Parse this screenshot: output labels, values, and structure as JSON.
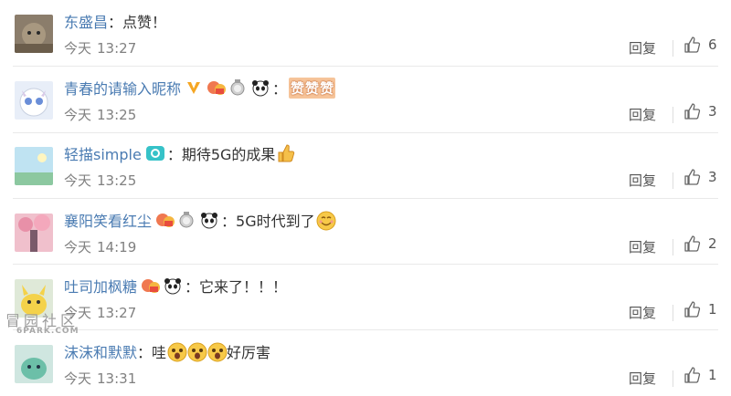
{
  "comments": [
    {
      "user": "东盛昌",
      "sep": "：",
      "text": "点赞！",
      "time_label": "今天",
      "time": "13:27",
      "reply": "回复",
      "likes": "6",
      "badges": [],
      "emoji": []
    },
    {
      "user": "青春的请输入昵称",
      "sep": "：",
      "text": "",
      "zan": [
        "赞",
        "赞",
        "赞"
      ],
      "time_label": "今天",
      "time": "13:25",
      "reply": "回复",
      "likes": "3",
      "badges": [
        "vip-v-icon",
        "fans-badge-icon",
        "medal-icon",
        "panda-icon"
      ],
      "emoji": []
    },
    {
      "user": "轻描simple",
      "sep": "：",
      "text": "期待5G的成果",
      "time_label": "今天",
      "time": "13:25",
      "reply": "回复",
      "likes": "3",
      "badges": [
        "camera-badge-icon"
      ],
      "emoji": [
        "thumbs-up-emoji"
      ]
    },
    {
      "user": "襄阳笑看红尘",
      "sep": "：",
      "text": "5G时代到了",
      "time_label": "今天",
      "time": "14:19",
      "reply": "回复",
      "likes": "2",
      "badges": [
        "fans-badge-icon",
        "medal-icon",
        "panda-icon"
      ],
      "emoji": [
        "smile-emoji"
      ]
    },
    {
      "user": "吐司加枫糖",
      "sep": "：",
      "text": "它来了！！！",
      "time_label": "今天",
      "time": "13:27",
      "reply": "回复",
      "likes": "1",
      "badges": [
        "fans-badge-icon",
        "panda-icon"
      ],
      "emoji": []
    },
    {
      "user": "沫沫和默默",
      "sep": "：",
      "text_before": "哇",
      "text_after": "好厉害",
      "time_label": "今天",
      "time": "13:31",
      "reply": "回复",
      "likes": "1",
      "badges": [],
      "emoji": [
        "surprised-emoji",
        "surprised-emoji",
        "surprised-emoji"
      ]
    }
  ],
  "watermark": {
    "cn": "冒园社区",
    "en": "6PARK.COM"
  },
  "colors": {
    "username": "#4a7bb2",
    "time": "#808080",
    "text": "#333333",
    "divider": "#e9e9e9"
  }
}
